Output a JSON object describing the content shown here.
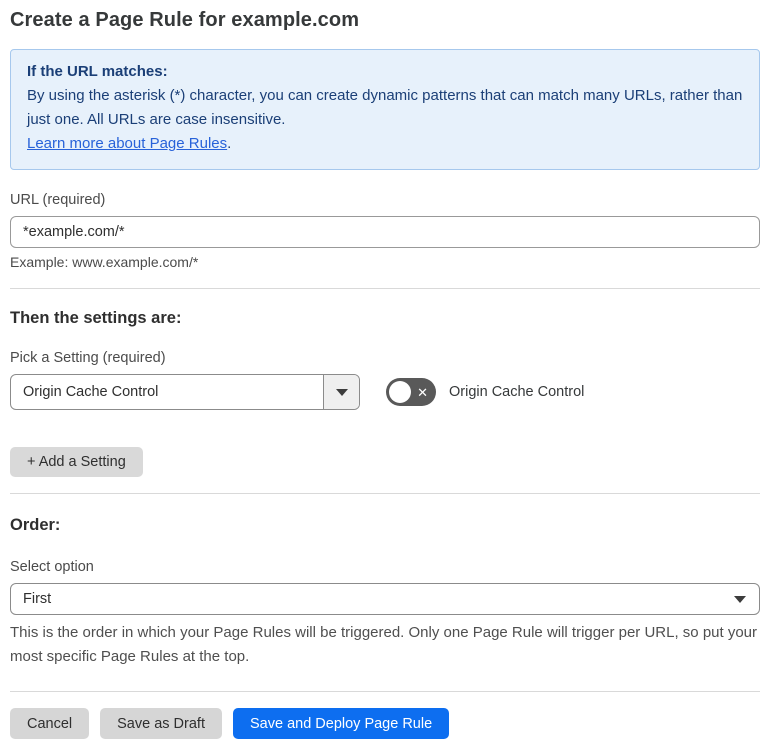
{
  "page": {
    "title": "Create a Page Rule for example.com"
  },
  "info_box": {
    "heading": "If the URL matches:",
    "body": "By using the asterisk (*) character, you can create dynamic patterns that can match many URLs, rather than just one. All URLs are case insensitive.",
    "link_label": "Learn more about Page Rules",
    "link_suffix": "."
  },
  "url_field": {
    "label": "URL (required)",
    "value": "*example.com/*",
    "helper": "Example: www.example.com/*"
  },
  "settings_section": {
    "heading": "Then the settings are:",
    "pick_label": "Pick a Setting (required)",
    "selected_setting": "Origin Cache Control",
    "toggle_state": "off",
    "toggle_label": "Origin Cache Control",
    "add_button_label": "+ Add a Setting"
  },
  "order_section": {
    "heading": "Order:",
    "select_label": "Select option",
    "selected_option": "First",
    "helper": "This is the order in which your Page Rules will be triggered. Only one Page Rule will trigger per URL, so put your most specific Page Rules at the top."
  },
  "footer": {
    "cancel_label": "Cancel",
    "save_draft_label": "Save as Draft",
    "save_deploy_label": "Save and Deploy Page Rule"
  },
  "colors": {
    "accent_blue": "#0d6ef0",
    "info_bg": "#e7f1fb",
    "info_border": "#a6c8ed",
    "info_text": "#1b3f77",
    "link_blue": "#2762d9",
    "toggle_off_bg": "#595959",
    "button_gray": "#d6d6d6",
    "divider": "#d9d9d9"
  }
}
